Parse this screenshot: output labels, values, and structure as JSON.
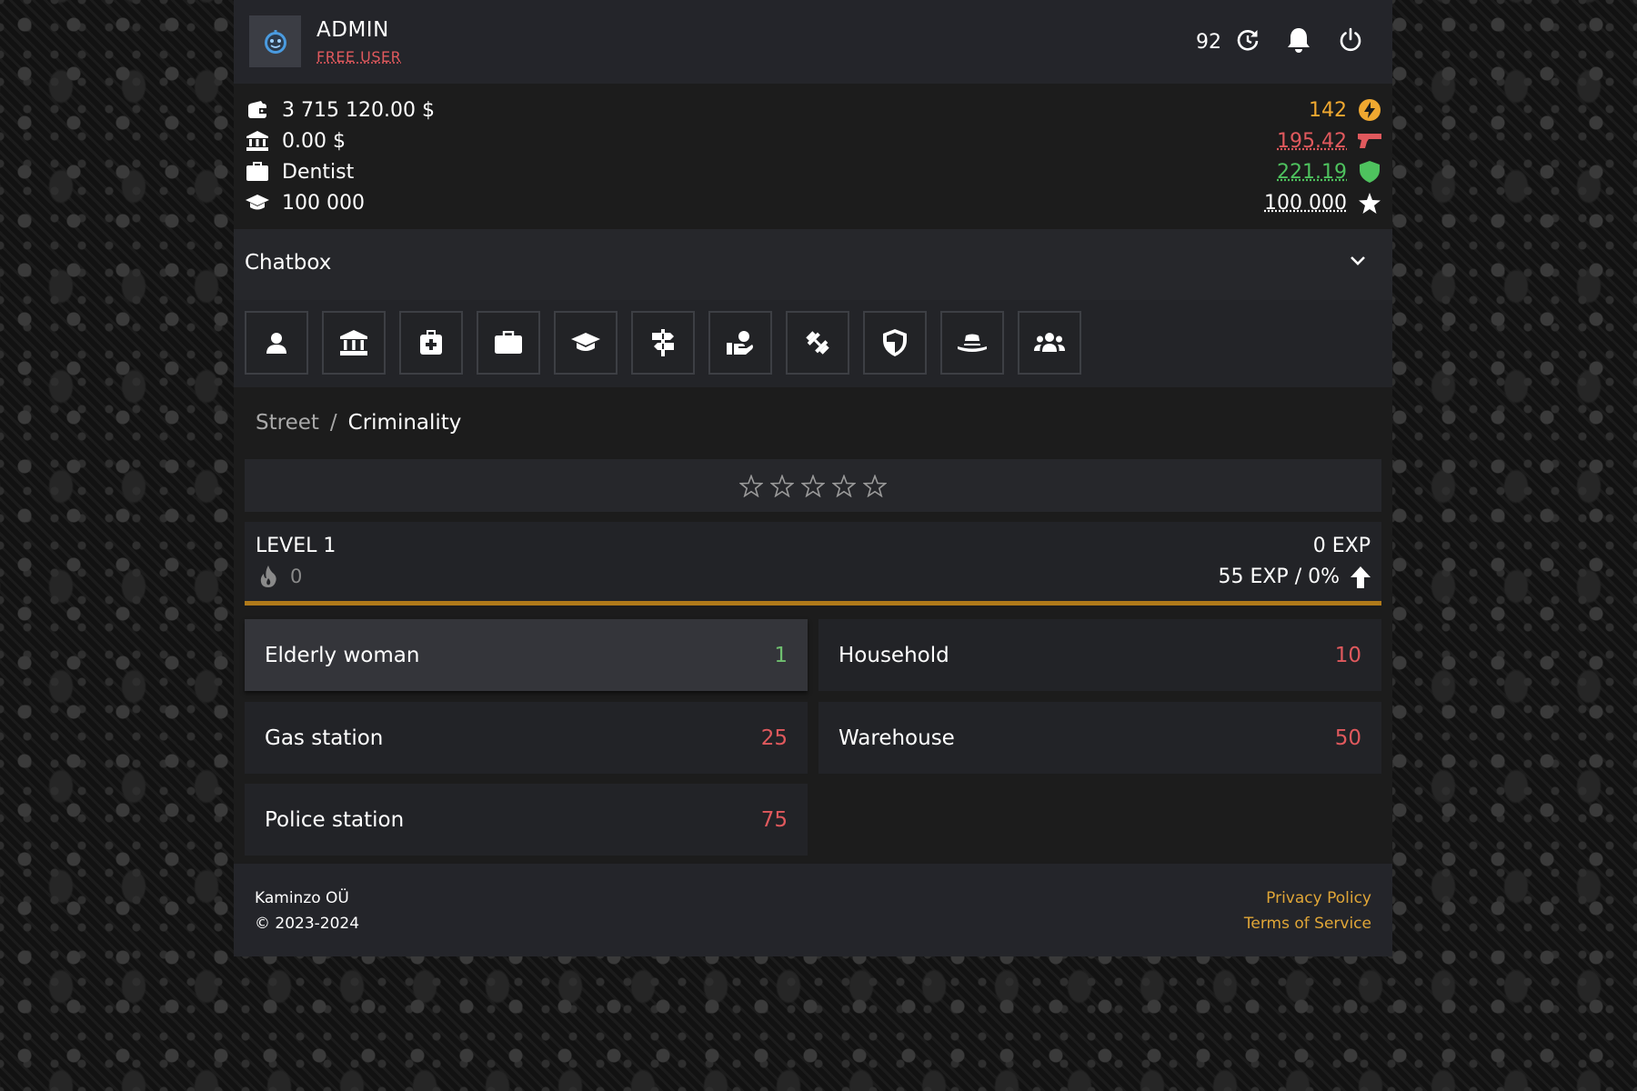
{
  "header": {
    "username": "ADMIN",
    "user_tier": "FREE USER",
    "counter": "92",
    "icons": {
      "avatar": "robot-face-icon",
      "refresh": "refresh-icon",
      "notifications": "bell-icon",
      "logout": "power-icon"
    }
  },
  "stats": {
    "left": [
      {
        "icon": "wallet-icon",
        "value": "3 715 120.00 $"
      },
      {
        "icon": "bank-icon",
        "value": "0.00 $"
      },
      {
        "icon": "briefcase-icon",
        "value": "Dentist"
      },
      {
        "icon": "graduation-cap-icon",
        "value": "100 000"
      }
    ],
    "right": [
      {
        "icon": "energy-bolt-icon",
        "value": "142",
        "color": "#f0a830"
      },
      {
        "icon": "pistol-icon",
        "value": "195.42",
        "color": "#e0595d"
      },
      {
        "icon": "shield-icon",
        "value": "221.19",
        "color": "#4ec25e"
      },
      {
        "icon": "star-icon",
        "value": "100 000",
        "color": "#ffffff"
      }
    ]
  },
  "chatbox": {
    "title": "Chatbox",
    "icon": "chevron-down-icon"
  },
  "nav": [
    {
      "name": "profile",
      "icon": "user-icon"
    },
    {
      "name": "bank",
      "icon": "bank-icon"
    },
    {
      "name": "hospital",
      "icon": "medkit-icon"
    },
    {
      "name": "job",
      "icon": "briefcase-icon"
    },
    {
      "name": "education",
      "icon": "graduation-cap-icon"
    },
    {
      "name": "street",
      "icon": "signpost-icon"
    },
    {
      "name": "charity",
      "icon": "hand-holding-icon"
    },
    {
      "name": "gym",
      "icon": "dumbbell-icon"
    },
    {
      "name": "defense",
      "icon": "shield-halved-icon"
    },
    {
      "name": "disguise",
      "icon": "hat-icon"
    },
    {
      "name": "gang",
      "icon": "users-icon"
    }
  ],
  "breadcrumb": {
    "parent": "Street",
    "separator": "/",
    "current": "Criminality"
  },
  "rating": {
    "filled": 0,
    "total": 5
  },
  "level": {
    "title": "LEVEL 1",
    "streak": "0",
    "exp": "0 EXP",
    "needed": "55 EXP / 0%",
    "progress": 0,
    "bar_color": "#b07a1a"
  },
  "crimes": [
    {
      "name": "Elderly woman",
      "value": "1",
      "color": "#6fbf6f",
      "selected": true
    },
    {
      "name": "Household",
      "value": "10",
      "color": "#e0595d",
      "selected": false
    },
    {
      "name": "Gas station",
      "value": "25",
      "color": "#e0595d",
      "selected": false
    },
    {
      "name": "Warehouse",
      "value": "50",
      "color": "#e0595d",
      "selected": false
    },
    {
      "name": "Police station",
      "value": "75",
      "color": "#e0595d",
      "selected": false
    }
  ],
  "footer": {
    "company": "Kaminzo OÜ",
    "copyright": "© 2023-2024",
    "privacy": "Privacy Policy",
    "terms": "Terms of Service",
    "link_color": "#e0a637"
  }
}
